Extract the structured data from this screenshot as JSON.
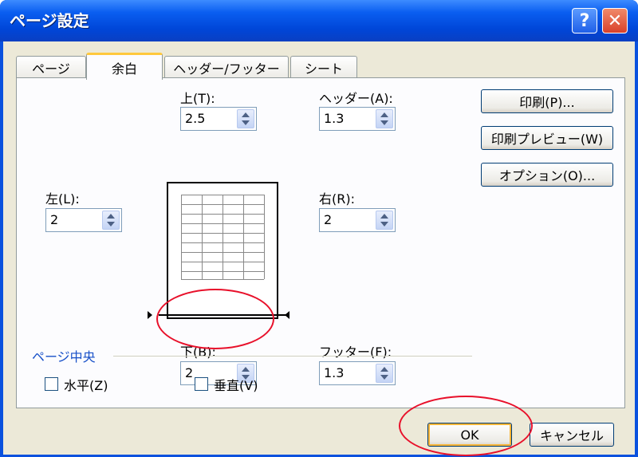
{
  "window": {
    "title": "ページ設定",
    "help": "?",
    "close": "✕"
  },
  "tabs": [
    {
      "label": "ページ"
    },
    {
      "label": "余白",
      "active": true
    },
    {
      "label": "ヘッダー/フッター"
    },
    {
      "label": "シート"
    }
  ],
  "margins": {
    "top": {
      "label": "上(T):",
      "value": "2.5"
    },
    "header": {
      "label": "ヘッダー(A):",
      "value": "1.3"
    },
    "left": {
      "label": "左(L):",
      "value": "2"
    },
    "right": {
      "label": "右(R):",
      "value": "2"
    },
    "bottom": {
      "label": "下(B):",
      "value": "2"
    },
    "footer": {
      "label": "フッター(F):",
      "value": "1.3"
    }
  },
  "side_buttons": {
    "print": "印刷(P)...",
    "print_preview": "印刷プレビュー(W)",
    "options": "オプション(O)..."
  },
  "center_on_page": {
    "title": "ページ中央",
    "horizontal": {
      "label": "水平(Z)",
      "checked": false
    },
    "vertical": {
      "label": "垂直(V)",
      "checked": false
    }
  },
  "footer_buttons": {
    "ok": "OK",
    "cancel": "キャンセル"
  },
  "colors": {
    "highlight": "#e8102a",
    "titlebar": "#0a5ef0"
  }
}
